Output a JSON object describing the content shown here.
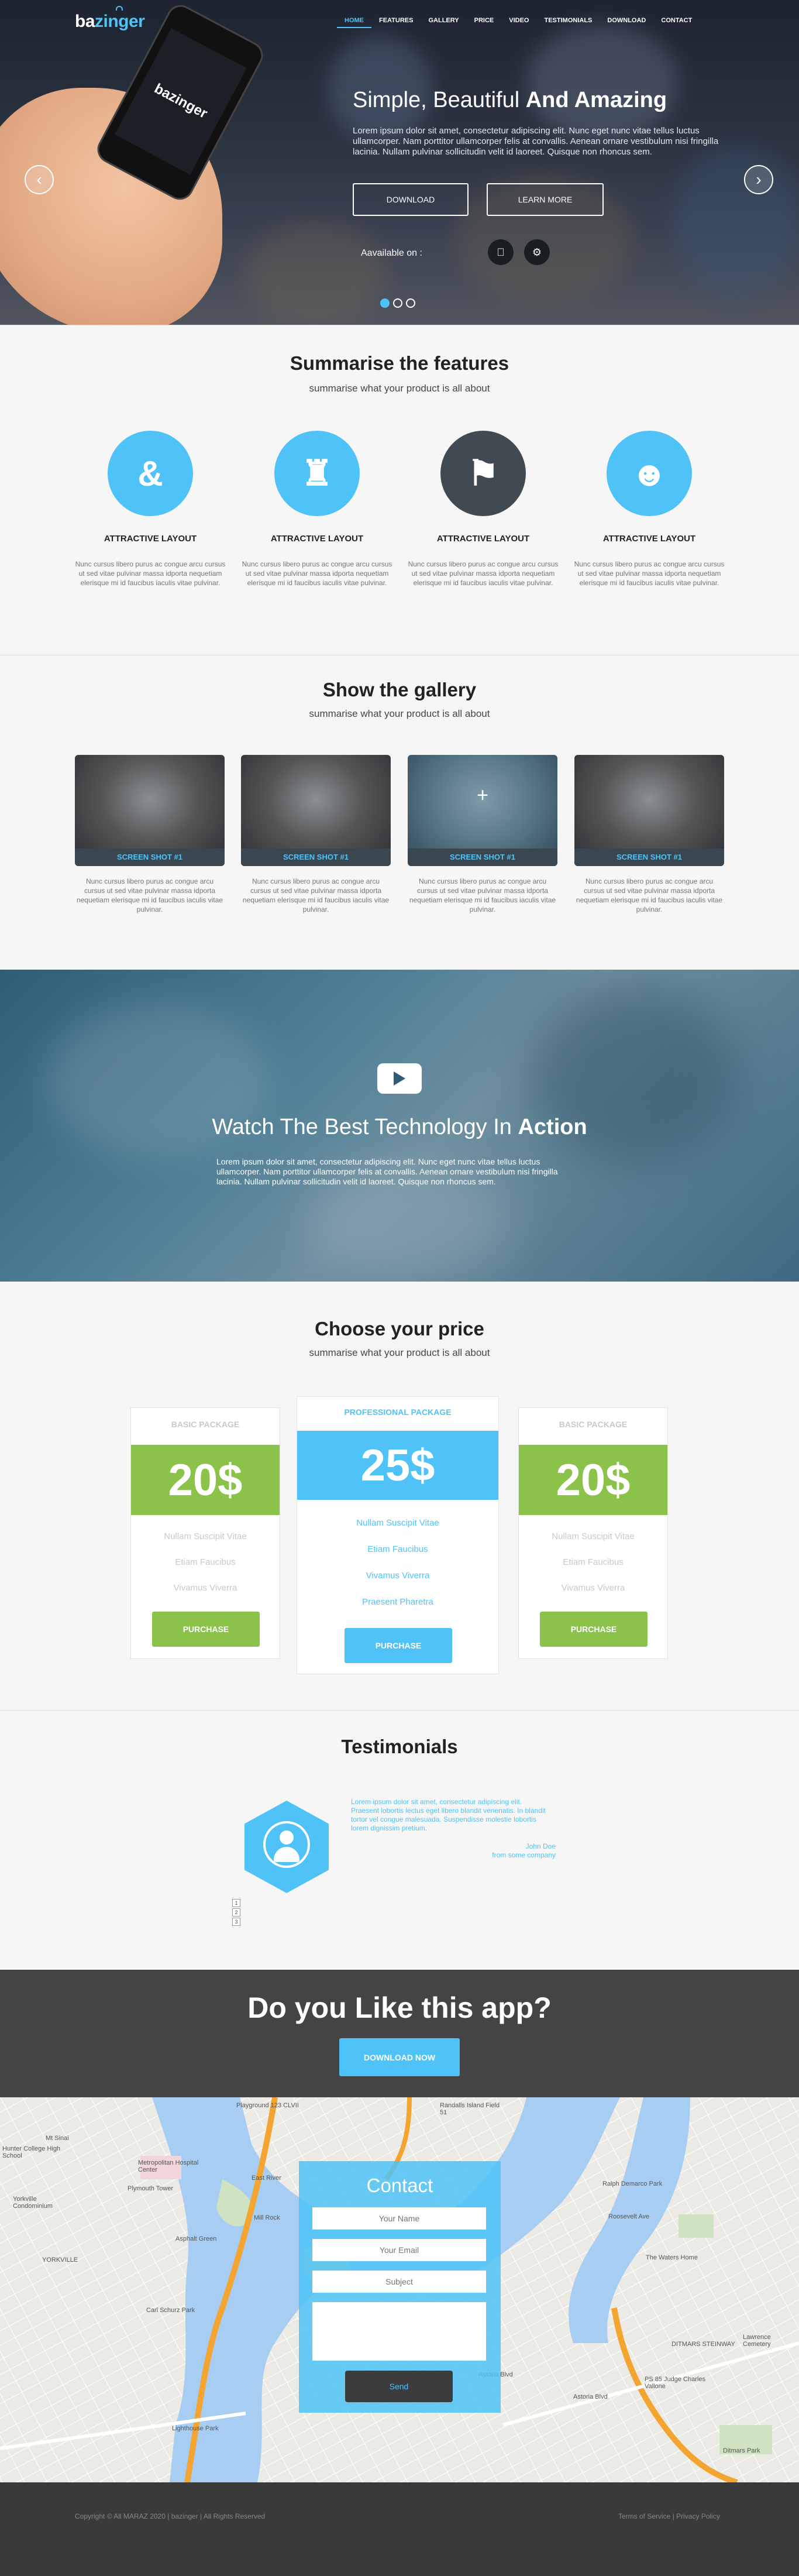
{
  "brand": {
    "logo_pre": "ba",
    "logo_post": "zinger"
  },
  "nav": [
    "HOME",
    "FEATURES",
    "GALLERY",
    "PRICE",
    "VIDEO",
    "TESTIMONIALS",
    "DOWNLOAD",
    "CONTACT"
  ],
  "hero": {
    "title_light": "Simple, Beautiful ",
    "title_bold": "And Amazing",
    "text": "Lorem ipsum dolor sit amet, consectetur adipiscing elit. Nunc eget nunc vitae tellus luctus ullamcorper. Nam porttitor ullamcorper felis at convallis. Aenean ornare vestibulum nisi fringilla lacinia. Nullam pulvinar sollicitudin velit id laoreet. Quisque non rhoncus sem.",
    "download_label": "DOWNLOAD",
    "learn_label": "LEARN MORE",
    "available_label": "Aavailable on :",
    "phone_logo": "bazinger",
    "active_slide": 1,
    "slide_count": 3
  },
  "features": {
    "title": "Summarise the features",
    "subtitle": "summarise what your product is all about",
    "items": [
      {
        "heading": "ATTRACTIVE LAYOUT",
        "text": "Nunc cursus libero purus ac congue arcu cursus ut sed vitae pulvinar massa idporta nequetiam elerisque mi id faucibus iaculis vitae pulvinar.",
        "color": "#4fc3f7",
        "icon": "ampersand-icon"
      },
      {
        "heading": "ATTRACTIVE LAYOUT",
        "text": "Nunc cursus libero purus ac congue arcu cursus ut sed vitae pulvinar massa idporta nequetiam elerisque mi id faucibus iaculis vitae pulvinar.",
        "color": "#4fc3f7",
        "icon": "castle-icon"
      },
      {
        "heading": "ATTRACTIVE LAYOUT",
        "text": "Nunc cursus libero purus ac congue arcu cursus ut sed vitae pulvinar massa idporta nequetiam elerisque mi id faucibus iaculis vitae pulvinar.",
        "color": "#414a52",
        "icon": "flag-icon"
      },
      {
        "heading": "ATTRACTIVE LAYOUT",
        "text": "Nunc cursus libero purus ac congue arcu cursus ut sed vitae pulvinar massa idporta nequetiam elerisque mi id faucibus iaculis vitae pulvinar.",
        "color": "#4fc3f7",
        "icon": "owl-icon"
      }
    ]
  },
  "gallery": {
    "title": "Show the gallery",
    "subtitle": "summarise what your product is all about",
    "items": [
      {
        "caption": "SCREEN SHOT #1",
        "text": "Nunc cursus libero purus ac congue arcu cursus ut sed vitae pulvinar massa idporta nequetiam elerisque mi id faucibus iaculis vitae pulvinar."
      },
      {
        "caption": "SCREEN SHOT #1",
        "text": "Nunc cursus libero purus ac congue arcu cursus ut sed vitae pulvinar massa idporta nequetiam elerisque mi id faucibus iaculis vitae pulvinar."
      },
      {
        "caption": "SCREEN SHOT #1",
        "text": "Nunc cursus libero purus ac congue arcu cursus ut sed vitae pulvinar massa idporta nequetiam elerisque mi id faucibus iaculis vitae pulvinar.",
        "hovered": true
      },
      {
        "caption": "SCREEN SHOT #1",
        "text": "Nunc cursus libero purus ac congue arcu cursus ut sed vitae pulvinar massa idporta nequetiam elerisque mi id faucibus iaculis vitae pulvinar."
      }
    ]
  },
  "video": {
    "title_light": "Watch The Best Technology In ",
    "title_bold": "Action",
    "text": "Lorem ipsum dolor sit amet, consectetur adipiscing elit. Nunc eget nunc vitae tellus luctus ullamcorper. Nam porttitor ullamcorper felis at convallis. Aenean ornare vestibulum nisi fringilla lacinia. Nullam pulvinar sollicitudin velit id laoreet. Quisque non rhoncus sem."
  },
  "pricing": {
    "title": "Choose your price",
    "subtitle": "summarise what your product is all about",
    "plans": [
      {
        "name": "BASIC PACKAGE",
        "price": "20$",
        "features": [
          "Nullam Suscipit Vitae",
          "Etiam Faucibus",
          "Vivamus Viverra"
        ],
        "button": "PURCHASE",
        "color": "#8bc34a"
      },
      {
        "name": "PROFESSIONAL PACKAGE",
        "price": "25$",
        "features": [
          "Nullam Suscipit Vitae",
          "Etiam Faucibus",
          "Vivamus Viverra",
          "Praesent Pharetra"
        ],
        "button": "PURCHASE",
        "color": "#4fc3f7"
      },
      {
        "name": "BASIC PACKAGE",
        "price": "20$",
        "features": [
          "Nullam Suscipit Vitae",
          "Etiam Faucibus",
          "Vivamus Viverra"
        ],
        "button": "PURCHASE",
        "color": "#8bc34a"
      }
    ]
  },
  "testimonials": {
    "title": "Testimonials",
    "quote": "Lorem ipsum dolor sit amet, consectetur adipiscing elit. Praesent lobortis lectus eget libero blandit venenatis. In blandit tortor vel congue malesuada. Suspendisse molestie lobortis lorem dignissim pretium.",
    "author": "John Doe",
    "company": "from some company",
    "pages": [
      "1",
      "2",
      "3"
    ]
  },
  "cta": {
    "heading": "Do you Like this app?",
    "button": "DOWNLOAD NOW"
  },
  "contact": {
    "title": "Contact",
    "name_placeholder": "Your Name",
    "email_placeholder": "Your Email",
    "subject_placeholder": "Subject",
    "send_label": "Send"
  },
  "map_labels": [
    "Playground 123 CLVII",
    "Randalls Island Field 51",
    "Mt Sinai",
    "Hunter College High School",
    "Metropolitan Hospital Center",
    "Plymouth Tower",
    "Yorkville Condominium",
    "Ralph Demarco Park",
    "Mill Rock",
    "Asphalt Green",
    "YORKVILLE",
    "The Waters Home",
    "DITMARS STEINWAY",
    "Lawrence Cemetery",
    "Carl Schurz Park",
    "Lighthouse Park",
    "Astoria Blvd",
    "Astoria Blvd",
    "PS 85 Judge Charles Vallone",
    "Ditmars Park",
    "East River",
    "Roosevelt Ave"
  ],
  "footer": {
    "left": "Copyright © All MARAZ 2020 | bazinger | All Rights Reserved",
    "right": "Terms of Service | Privacy Policy"
  }
}
